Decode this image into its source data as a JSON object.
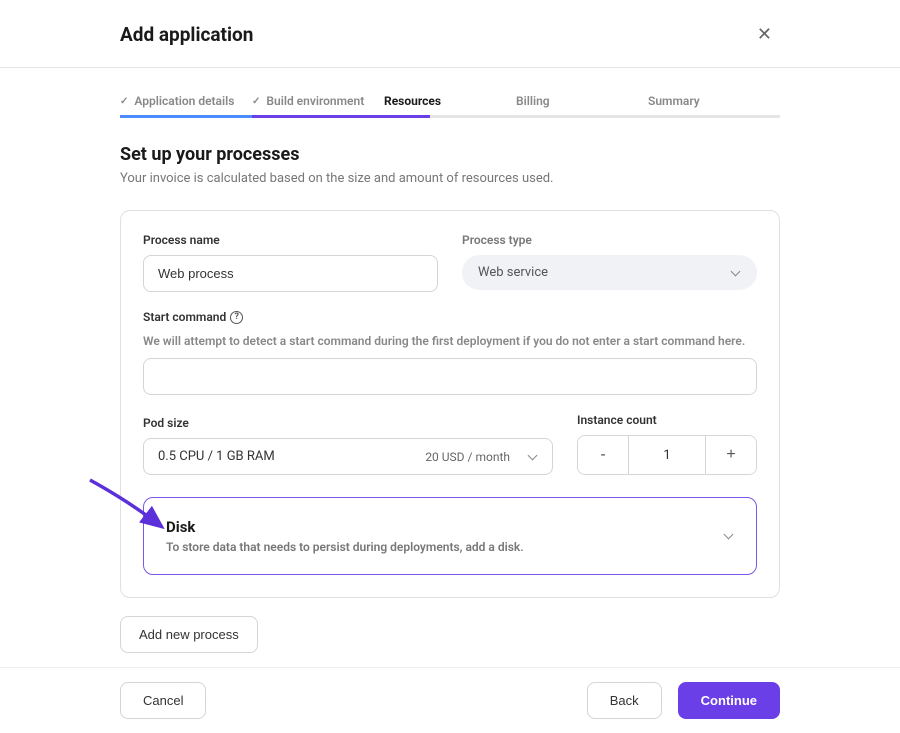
{
  "modal": {
    "title": "Add application"
  },
  "steps": [
    {
      "label": "Application details",
      "completed": true
    },
    {
      "label": "Build environment",
      "completed": true
    },
    {
      "label": "Resources",
      "active": true
    },
    {
      "label": "Billing"
    },
    {
      "label": "Summary"
    }
  ],
  "section": {
    "title": "Set up your processes",
    "subtitle": "Your invoice is calculated based on the size and amount of resources used."
  },
  "process": {
    "name_label": "Process name",
    "name_value": "Web process",
    "type_label": "Process type",
    "type_value": "Web service",
    "start_cmd_label": "Start command",
    "start_cmd_hint": "We will attempt to detect a start command during the first deployment if you do not enter a start command here.",
    "start_cmd_value": "",
    "pod_size_label": "Pod size",
    "pod_size_value": "0.5 CPU / 1 GB RAM",
    "pod_size_price": "20 USD / month",
    "instance_label": "Instance count",
    "instance_value": "1"
  },
  "disk": {
    "title": "Disk",
    "desc": "To store data that needs to persist during deployments, add a disk."
  },
  "buttons": {
    "add_process": "Add new process",
    "cancel": "Cancel",
    "back": "Back",
    "continue": "Continue"
  }
}
